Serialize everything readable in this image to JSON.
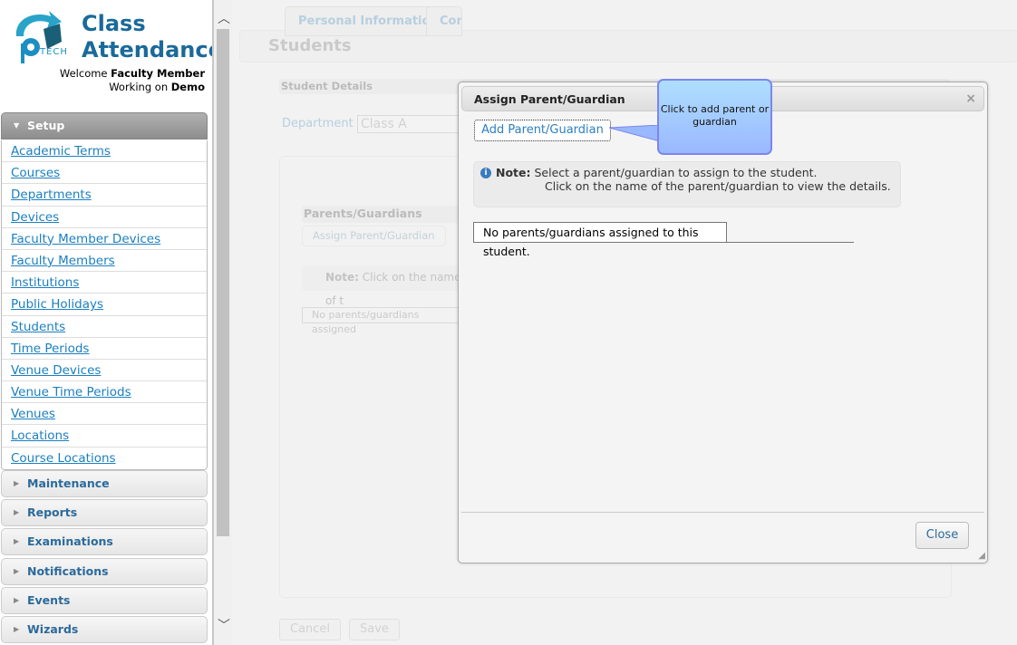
{
  "app": {
    "title_line1": "Class",
    "title_line2": "Attendance",
    "logo_text": "iPTECH",
    "welcome_prefix": "Welcome ",
    "user": "Faculty Member",
    "working_prefix": "Working on ",
    "workspace": "Demo"
  },
  "sidebar": {
    "active_section": "Setup",
    "setup_items": [
      "Academic Terms",
      "Courses",
      "Departments",
      "Devices",
      "Faculty Member Devices",
      "Faculty Members",
      "Institutions",
      "Public Holidays",
      "Students",
      "Time Periods",
      "Venue Devices",
      "Venue Time Periods",
      "Venues",
      "Locations",
      "Course Locations"
    ],
    "sections": [
      "Maintenance",
      "Reports",
      "Examinations",
      "Notifications",
      "Events",
      "Wizards"
    ]
  },
  "background": {
    "page_title": "Students",
    "section": "Student Details",
    "department_label": "Department",
    "department_value": "Class A",
    "tabs": [
      "Personal Information",
      "Con"
    ],
    "parents_header": "Parents/Guardians",
    "assign_button": "Assign Parent/Guardian",
    "note_label": "Note:",
    "note_text": " Click on the name of t",
    "none_text": "No parents/guardians assigned",
    "cancel": "Cancel",
    "save": "Save"
  },
  "dialog": {
    "title": "Assign Parent/Guardian",
    "close_icon": "×",
    "add_button": "Add Parent/Guardian",
    "note_label": "Note:",
    "note_line1": " Select a parent/guardian to assign to the student.",
    "note_line2": "Click on the name of the parent/guardian to view the details.",
    "none_text": "No parents/guardians assigned to this student.",
    "close_button": "Close"
  },
  "tooltip": {
    "text": "Click to add parent or guardian"
  },
  "colors": {
    "link": "#1b7fc0",
    "brand": "#1a6a9a",
    "tooltip": "#a8d0ff"
  }
}
